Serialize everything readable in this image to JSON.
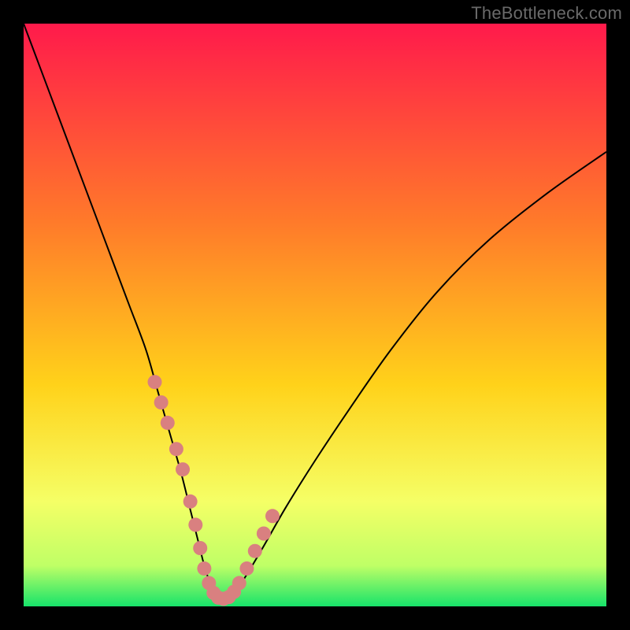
{
  "watermark": "TheBottleneck.com",
  "colors": {
    "gradient_top": "#ff1a4b",
    "gradient_upper_mid": "#ff7a2a",
    "gradient_mid": "#ffd21a",
    "gradient_lower_mid": "#f5ff66",
    "gradient_near_bottom": "#bfff66",
    "gradient_bottom": "#17e36a",
    "curve": "#000000",
    "marker": "#d98080",
    "frame": "#000000"
  },
  "chart_data": {
    "type": "line",
    "title": "",
    "xlabel": "",
    "ylabel": "",
    "xlim": [
      0,
      100
    ],
    "ylim": [
      0,
      100
    ],
    "series": [
      {
        "name": "bottleneck-curve",
        "x": [
          0,
          3,
          6,
          9,
          12,
          15,
          18,
          21,
          23,
          25,
          27,
          28.5,
          30,
          31,
          32,
          33,
          34.5,
          36,
          38,
          41,
          45,
          50,
          56,
          63,
          71,
          80,
          90,
          100
        ],
        "y": [
          100,
          92,
          84,
          76,
          68,
          60,
          52,
          44,
          37,
          30,
          23,
          17,
          11,
          7,
          4,
          2,
          1,
          2,
          5,
          10,
          17,
          25,
          34,
          44,
          54,
          63,
          71,
          78
        ]
      }
    ],
    "markers": {
      "name": "highlight-points",
      "x": [
        22.5,
        23.6,
        24.7,
        26.2,
        27.3,
        28.6,
        29.5,
        30.3,
        31.0,
        31.8,
        32.6,
        33.4,
        34.3,
        35.2,
        36.1,
        37.0,
        38.3,
        39.7,
        41.2,
        42.7
      ],
      "y": [
        38.5,
        35,
        31.5,
        27,
        23.5,
        18,
        14,
        10,
        6.5,
        4,
        2.3,
        1.5,
        1.3,
        1.6,
        2.5,
        4,
        6.5,
        9.5,
        12.5,
        15.5
      ]
    }
  }
}
